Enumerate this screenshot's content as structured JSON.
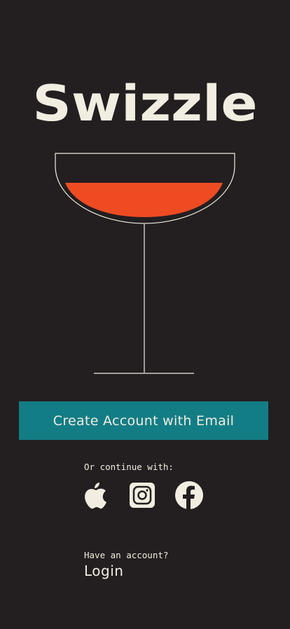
{
  "app": {
    "title": "Swizzle"
  },
  "colors": {
    "background": "#231f20",
    "cream": "#f1ede1",
    "accent_teal": "#137d85",
    "drink_orange": "#ef4b23"
  },
  "illustration": {
    "icon": "cocktail-glass-icon"
  },
  "cta": {
    "label": "Create Account with Email"
  },
  "social": {
    "label": "Or continue with:",
    "providers": [
      {
        "name": "Apple",
        "icon": "apple-icon"
      },
      {
        "name": "Instagram",
        "icon": "instagram-icon"
      },
      {
        "name": "Facebook",
        "icon": "facebook-icon"
      }
    ]
  },
  "account": {
    "prompt": "Have an account?",
    "login_label": "Login"
  }
}
